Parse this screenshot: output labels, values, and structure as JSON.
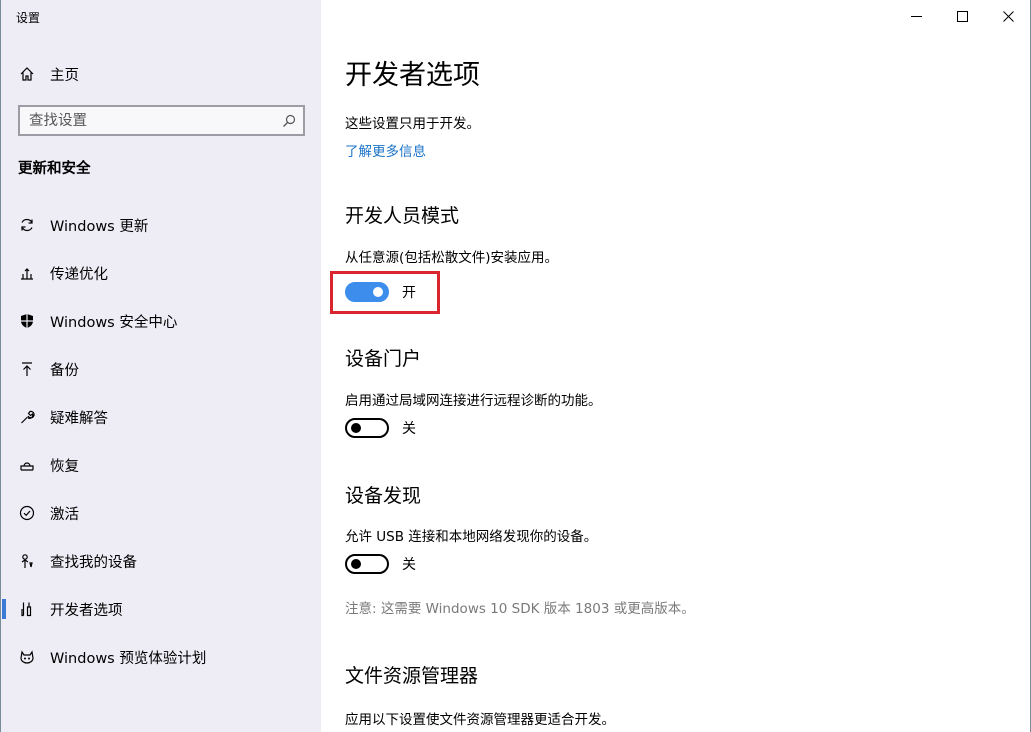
{
  "app_title": "设置",
  "sidebar": {
    "home_label": "主页",
    "search_placeholder": "查找设置",
    "section_heading": "更新和安全",
    "items": [
      {
        "label": "Windows 更新",
        "icon": "sync-icon"
      },
      {
        "label": "传递优化",
        "icon": "delivery-optimization-icon"
      },
      {
        "label": "Windows 安全中心",
        "icon": "shield-icon"
      },
      {
        "label": "备份",
        "icon": "backup-icon"
      },
      {
        "label": "疑难解答",
        "icon": "wrench-icon"
      },
      {
        "label": "恢复",
        "icon": "recovery-icon"
      },
      {
        "label": "激活",
        "icon": "check-circle-icon"
      },
      {
        "label": "查找我的设备",
        "icon": "person-pin-icon"
      },
      {
        "label": "开发者选项",
        "icon": "developer-tools-icon",
        "selected": true
      },
      {
        "label": "Windows 预览体验计划",
        "icon": "insider-cat-icon"
      }
    ]
  },
  "main": {
    "title": "开发者选项",
    "intro": "这些设置只用于开发。",
    "learn_more": "了解更多信息",
    "developer_mode": {
      "heading": "开发人员模式",
      "description": "从任意源(包括松散文件)安装应用。",
      "state": "开",
      "on": true
    },
    "device_portal": {
      "heading": "设备门户",
      "description": "启用通过局域网连接进行远程诊断的功能。",
      "state": "关",
      "on": false
    },
    "device_discovery": {
      "heading": "设备发现",
      "description": "允许 USB 连接和本地网络发现你的设备。",
      "state": "关",
      "on": false,
      "note": "注意: 这需要 Windows 10 SDK 版本 1803 或更高版本。"
    },
    "file_explorer": {
      "heading": "文件资源管理器",
      "description": "应用以下设置使文件资源管理器更适合开发。"
    }
  },
  "colors": {
    "accent": "#3d8eec",
    "link": "#1a73c8",
    "highlight": "#d9262e",
    "sidebar_bg": "#eeedf6"
  }
}
